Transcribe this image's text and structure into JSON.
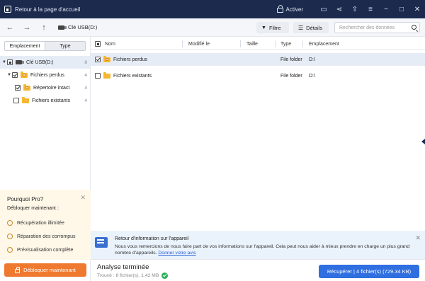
{
  "titlebar": {
    "home_label": "Retour à la page d'accueil",
    "activate_label": "Activer",
    "icons": [
      "feedback-icon",
      "share-icon",
      "upload-icon",
      "menu-icon",
      "minimize-icon",
      "maximize-icon",
      "close-icon"
    ],
    "icon_glyphs": [
      "▭",
      "⋖",
      "⇧",
      "≡",
      "−",
      "□",
      "✕"
    ]
  },
  "toolbar": {
    "back_glyph": "←",
    "forward_glyph": "→",
    "up_glyph": "↑",
    "path": "Clé USB(D:)",
    "filter_label": "Filtre",
    "details_label": "Détails",
    "search_placeholder": "Rechercher des données"
  },
  "sidebar": {
    "tabs": [
      "Emplacement",
      "Type"
    ],
    "tree": [
      {
        "label": "Clé USB(D:)",
        "count": "8",
        "state": "partial",
        "caret": "▼"
      },
      {
        "label": "Fichiers perdus",
        "count": "4",
        "state": "checked",
        "caret": "▼"
      },
      {
        "label": "Répertoire intact",
        "count": "4",
        "state": "checked",
        "caret": ""
      },
      {
        "label": "Fichiers existants",
        "count": "4",
        "state": "empty",
        "caret": ""
      }
    ]
  },
  "promo": {
    "title": "Pourquoi Pro?",
    "subtitle": "Débloquer maintenant :",
    "features": [
      "Récupération illimitée",
      "Réparation des corrompus",
      "Prévisualisation complète"
    ],
    "button": "Débloquer maintenant"
  },
  "table": {
    "columns": [
      "Nom",
      "Modifié le",
      "Taille",
      "Type",
      "Emplacement"
    ],
    "rows": [
      {
        "name": "Fichiers perdus",
        "modified": "",
        "size": "",
        "type": "File folder",
        "location": "D:\\"
      },
      {
        "name": "Fichiers existants",
        "modified": "",
        "size": "",
        "type": "File folder",
        "location": "D:\\"
      }
    ]
  },
  "feedback": {
    "title": "Retour d'information sur l'appareil",
    "text": "Nous vous remercions de nous faire part de vos informations sur l'appareil. Cela peut nous aider à mieux prendre en charge un plus grand nombre d'appareils.",
    "link": "Donner votre avis"
  },
  "status": {
    "title": "Analyse terminée",
    "subtitle": "Trouvé : 8 fichier(s), 1.42 MB",
    "recover_button": "Récupérer | 4 fichier(s) (729.34 KB)"
  }
}
